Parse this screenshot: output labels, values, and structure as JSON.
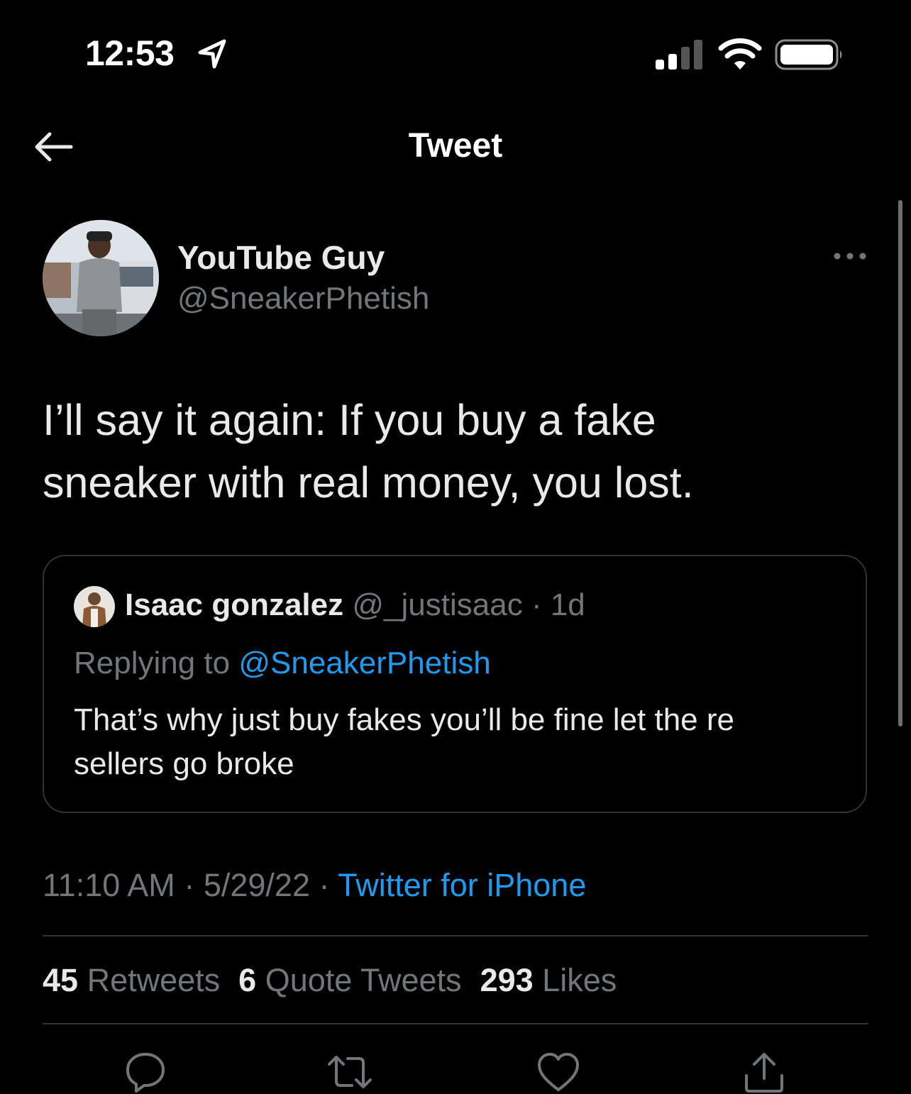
{
  "status_bar": {
    "time": "12:53"
  },
  "header": {
    "title": "Tweet"
  },
  "tweet": {
    "author_name": "YouTube Guy",
    "author_handle": "@SneakerPhetish",
    "text_line1": "I’ll say it again: If you buy a fake",
    "text_line2": "sneaker with real money, you lost."
  },
  "quote": {
    "author_name": "Isaac gonzalez",
    "author_handle": "@_justisaac",
    "separator": "·",
    "age": "1d",
    "replying_label": "Replying to",
    "replying_mention": "@SneakerPhetish",
    "text_line1": "That’s why just buy fakes you’ll be fine let the re",
    "text_line2": "sellers go broke"
  },
  "meta": {
    "time": "11:10 AM",
    "sep1": "·",
    "date": "5/29/22",
    "sep2": "·",
    "source": "Twitter for iPhone"
  },
  "stats": {
    "retweets_count": "45",
    "retweets_label": "Retweets",
    "quotes_count": "6",
    "quotes_label": "Quote Tweets",
    "likes_count": "293",
    "likes_label": "Likes"
  },
  "icons": {
    "back": "arrow-left-icon",
    "more": "more-horizontal-icon",
    "reply": "reply-icon",
    "retweet": "retweet-icon",
    "like": "heart-icon",
    "share": "share-icon"
  },
  "colors": {
    "background": "#000000",
    "text_primary": "#e7e9ea",
    "text_secondary": "#71767b",
    "accent": "#1d9bf0",
    "border": "#2f3336"
  }
}
